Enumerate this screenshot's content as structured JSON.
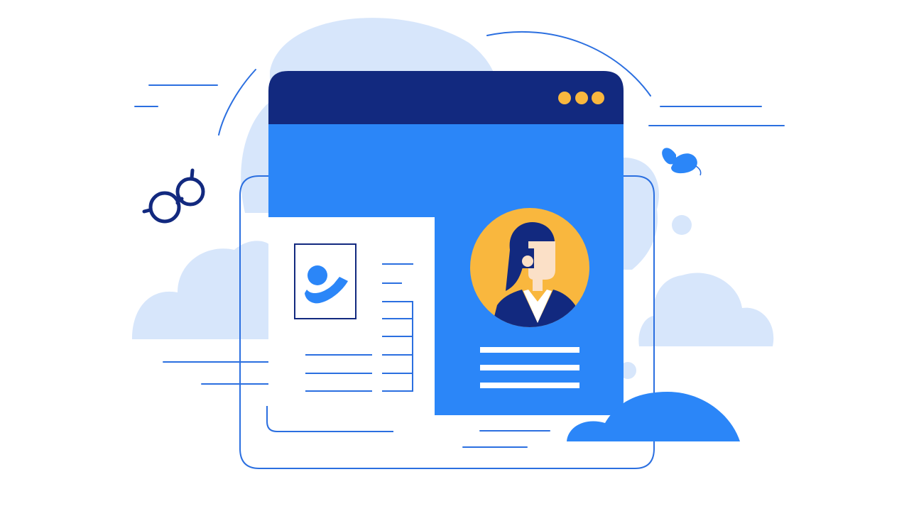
{
  "illustration": {
    "subject": "profile-card-browser-window",
    "icons": {
      "window_controls": "dots-icon",
      "photo": "photo-icon",
      "avatar": "woman-avatar",
      "eyeglasses": "glasses-icon",
      "butterfly": "butterfly-icon",
      "clouds": "cloud-icon"
    },
    "colors": {
      "background": "#ffffff",
      "cloud_light": "#d7e6fb",
      "window_header": "#12297f",
      "window_body": "#2b86f8",
      "control_dots": "#f9b73e",
      "avatar_circle": "#f9b73e",
      "hair_jacket": "#12297f",
      "skin": "#fbe0c7",
      "card_white": "#ffffff",
      "outline": "#2b6fe0"
    }
  }
}
